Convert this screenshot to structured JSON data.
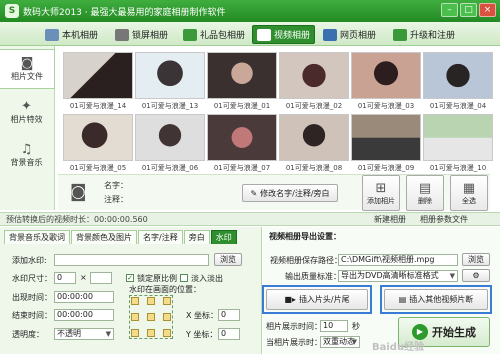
{
  "window": {
    "title": "数码大师2013 · 最强大最易用的家庭相册制作软件",
    "app_icon_letter": "S",
    "controls": [
      "–",
      "□",
      "×"
    ]
  },
  "toolbar": {
    "tabs": [
      {
        "label": "本机相册",
        "icon": "computer-icon",
        "color": "#6a8fb8"
      },
      {
        "label": "锁屏相册",
        "icon": "monitor-icon",
        "color": "#777777"
      },
      {
        "label": "礼品包相册",
        "icon": "gift-icon",
        "color": "#3a9a3a"
      },
      {
        "label": "视频相册",
        "icon": "film-icon",
        "color": "#ffffff",
        "active": true
      },
      {
        "label": "网页相册",
        "icon": "web-icon",
        "color": "#3a6fb0"
      },
      {
        "label": "升级和注册",
        "icon": "upgrade-icon",
        "color": "#3a9a3a"
      }
    ]
  },
  "left_nav": [
    {
      "label": "相片文件",
      "icon": "camera-icon",
      "active": true
    },
    {
      "label": "相片特效",
      "icon": "effects-icon"
    },
    {
      "label": "背景音乐",
      "icon": "music-note-icon"
    }
  ],
  "gallery": {
    "items": [
      {
        "label": "01可爱与浪漫_14",
        "colors": [
          "#d8d2cc",
          "#2b2020"
        ]
      },
      {
        "label": "01可爱与浪漫_13",
        "colors": [
          "#e4eef2",
          "#3a3436"
        ]
      },
      {
        "label": "01可爱与浪漫_01",
        "colors": [
          "#3a3030",
          "#c9a89a"
        ]
      },
      {
        "label": "01可爱与浪漫_02",
        "colors": [
          "#d3c6bf",
          "#4a2a2a"
        ]
      },
      {
        "label": "01可爱与浪漫_03",
        "colors": [
          "#caa294",
          "#2c1e1e"
        ]
      },
      {
        "label": "01可爱与浪漫_04",
        "colors": [
          "#b8c6d8",
          "#282424"
        ]
      },
      {
        "label": "01可爱与浪漫_05",
        "colors": [
          "#e2dcd2",
          "#3a2a2a"
        ]
      },
      {
        "label": "01可爱与浪漫_06",
        "colors": [
          "#dedede",
          "#403434"
        ]
      },
      {
        "label": "01可爱与浪漫_07",
        "colors": [
          "#4a3a3a",
          "#c07878"
        ]
      },
      {
        "label": "01可爱与浪漫_08",
        "colors": [
          "#cfc2b8",
          "#2e2424"
        ]
      },
      {
        "label": "01可爱与浪漫_09",
        "colors": [
          "#9a8a7a",
          "#3a3a3a"
        ]
      },
      {
        "label": "01可爱与浪漫_10",
        "colors": [
          "#b8d4b0",
          "#e6e6e6"
        ]
      }
    ]
  },
  "photo_info": {
    "name_label": "名字：",
    "note_label": "注释：",
    "modify_button": "修改名字/注释/旁白",
    "add_button": "添加相片",
    "delete_button": "删除",
    "select_all_button": "全选"
  },
  "status": {
    "estimated_duration": "预估转换后的视频时长：00:00:00.560",
    "new_album": "新建相册",
    "album_params": "相册参数文件"
  },
  "settings": {
    "tabs": [
      "背景音乐及歌词",
      "背景颜色及图片",
      "名字/注释",
      "旁白",
      "水印"
    ],
    "active_tab": "水印",
    "add_watermark_label": "添加水印:",
    "browse_button": "浏览",
    "size_label": "水印尺寸：",
    "size_value": "0",
    "size_x": "×",
    "lock_ratio": "锁定原比例",
    "fade_in_out": "淡入淡出",
    "appear_time_label": "出现时间：",
    "appear_time_value": "00:00:00",
    "end_time_label": "结束时间：",
    "end_time_value": "00:00:00",
    "position_label": "水印在画面的位置：",
    "transparency_label": "透明度：",
    "transparency_value": "不透明",
    "x_label": "X 坐标：",
    "x_value": "0",
    "y_label": "Y 坐标：",
    "y_value": "0"
  },
  "export": {
    "title": "视频相册导出设置：",
    "save_path_label": "视频相册保存路径：",
    "save_path_value": "C:\\DMGift\\视频相册.mpg",
    "browse_button": "浏览",
    "quality_label": "输出质量标准：",
    "quality_value": "导出为DVD高清晰标准格式",
    "insert_head_tail_button": "插入片头/片尾",
    "insert_other_video_button": "插入其他视频片断",
    "photo_duration_label": "相片展示时间：",
    "photo_duration_value": "10",
    "seconds_unit": "秒",
    "display_mode_label": "当相片展示时：",
    "display_mode_value": "双重动态",
    "start_button": "开始生成",
    "highlight_color": "#3a7bd5"
  },
  "watermark_text": "Baidu经验"
}
